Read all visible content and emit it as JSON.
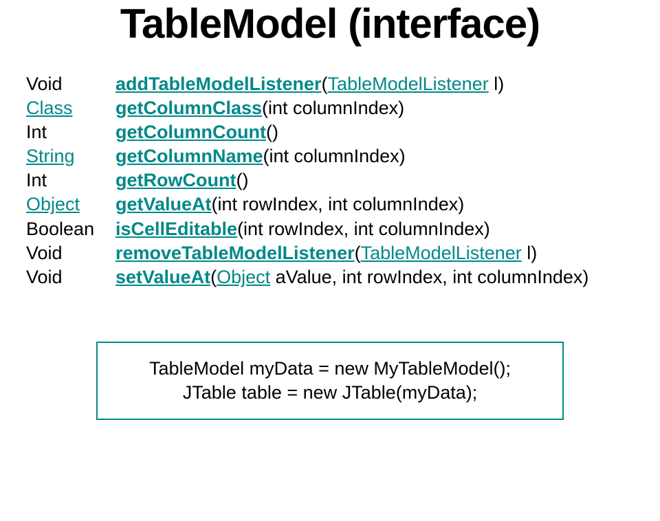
{
  "title": "TableModel (interface)",
  "methods": [
    {
      "returnTypeText": "Void",
      "returnTypeClass": "",
      "methodName": "addTableModelListener",
      "afterOpen": "(",
      "paramLinkText": "TableModelListener",
      "paramRest": " l)"
    },
    {
      "returnTypeText": "Class",
      "returnTypeClass": "teal underline",
      "methodName": "getColumnClass",
      "afterOpen": "(int columnIndex)",
      "paramLinkText": "",
      "paramRest": ""
    },
    {
      "returnTypeText": "Int",
      "returnTypeClass": "",
      "methodName": "getColumnCount",
      "afterOpen": "()",
      "paramLinkText": "",
      "paramRest": ""
    },
    {
      "returnTypeText": "String",
      "returnTypeClass": "teal underline",
      "methodName": "getColumnName",
      "afterOpen": "(int columnIndex)",
      "paramLinkText": "",
      "paramRest": ""
    },
    {
      "returnTypeText": "Int",
      "returnTypeClass": "",
      "methodName": "getRowCount",
      "afterOpen": "()",
      "paramLinkText": "",
      "paramRest": ""
    },
    {
      "returnTypeText": "Object",
      "returnTypeClass": "teal underline",
      "methodName": "getValueAt",
      "afterOpen": "(int rowIndex, int columnIndex)",
      "paramLinkText": "",
      "paramRest": ""
    },
    {
      "returnTypeText": "Boolean",
      "returnTypeClass": "",
      "methodName": "isCellEditable",
      "afterOpen": "(int rowIndex, int columnIndex)",
      "paramLinkText": "",
      "paramRest": ""
    },
    {
      "returnTypeText": "Void",
      "returnTypeClass": "",
      "methodName": "removeTableModelListener",
      "afterOpen": "(",
      "paramLinkText": "TableModelListener",
      "paramRest": " l)"
    },
    {
      "returnTypeText": "Void",
      "returnTypeClass": "",
      "methodName": "setValueAt",
      "afterOpen": "(",
      "paramLinkText": "Object",
      "paramRest": " aValue, int rowIndex, int columnIndex)"
    }
  ],
  "codeBox": {
    "line1": "TableModel myData = new MyTableModel();",
    "line2": "JTable table = new JTable(myData);"
  }
}
